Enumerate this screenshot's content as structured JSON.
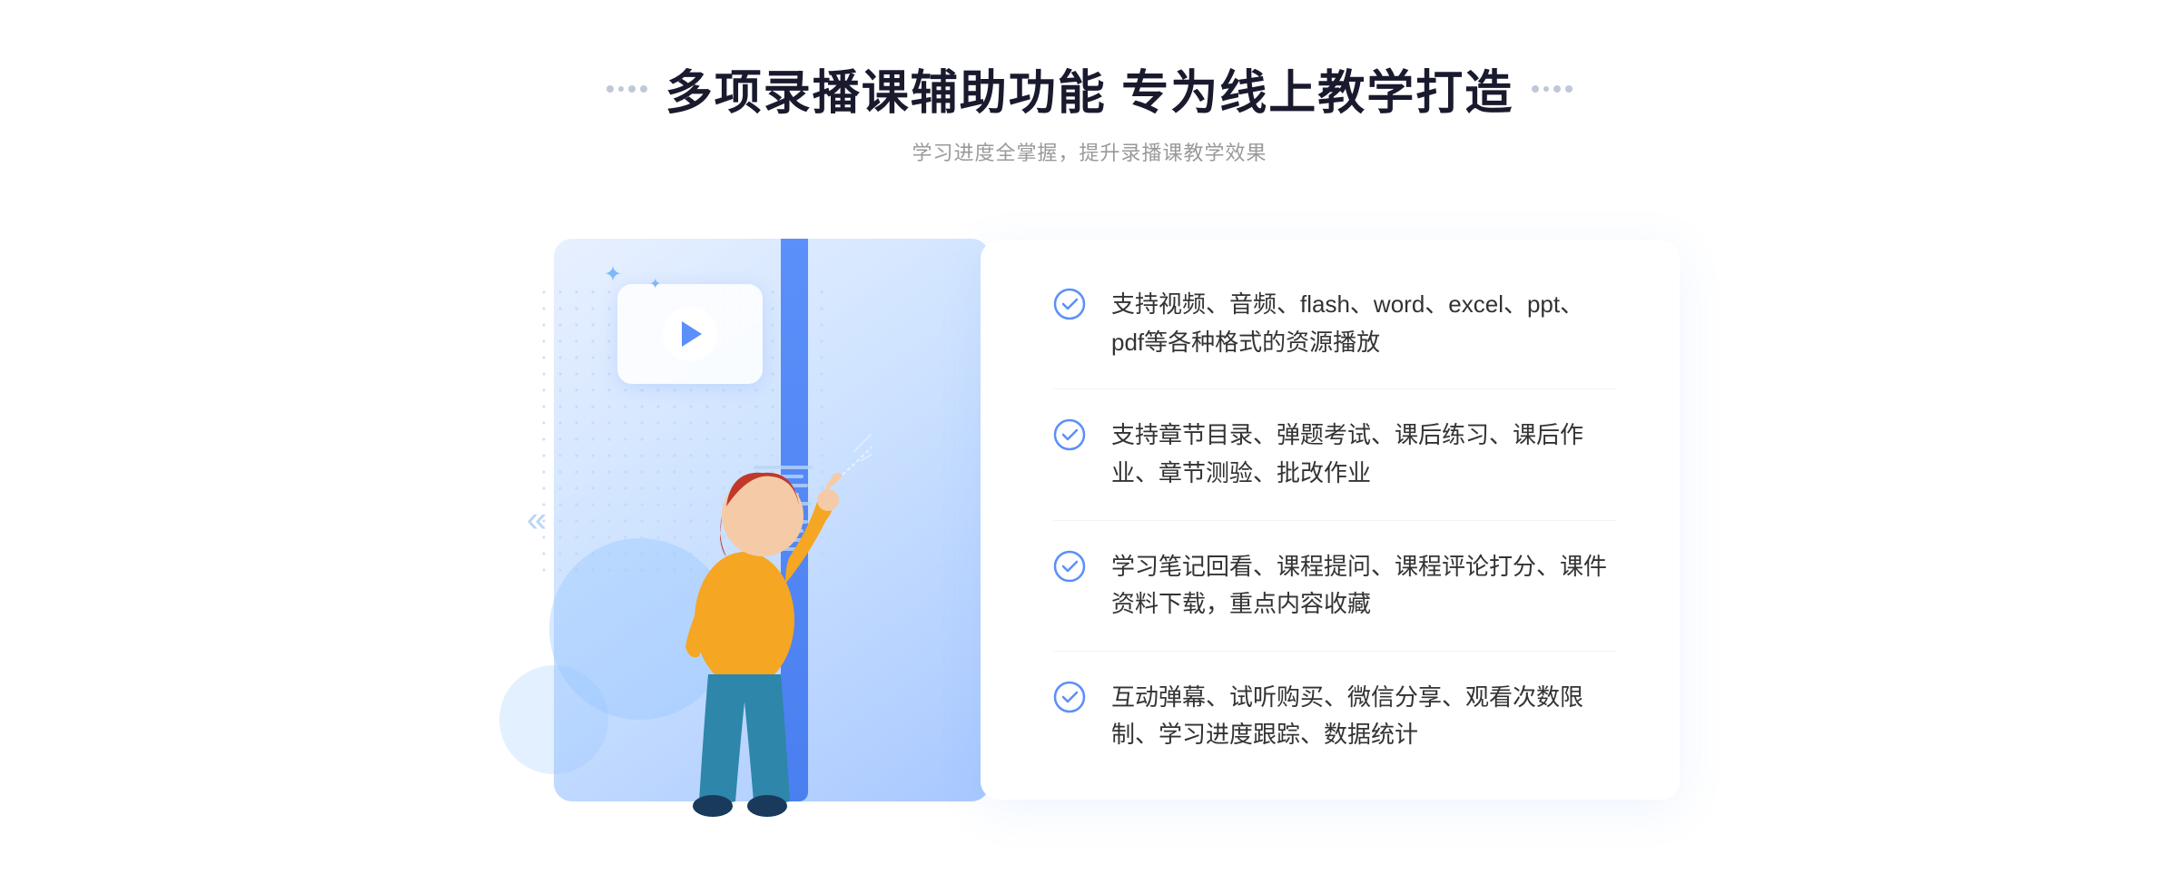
{
  "header": {
    "title": "多项录播课辅助功能 专为线上教学打造",
    "subtitle": "学习进度全掌握，提升录播课教学效果",
    "dots_left": "decorative dots left",
    "dots_right": "decorative dots right"
  },
  "features": [
    {
      "id": 1,
      "text": "支持视频、音频、flash、word、excel、ppt、pdf等各种格式的资源播放"
    },
    {
      "id": 2,
      "text": "支持章节目录、弹题考试、课后练习、课后作业、章节测验、批改作业"
    },
    {
      "id": 3,
      "text": "学习笔记回看、课程提问、课程评论打分、课件资料下载，重点内容收藏"
    },
    {
      "id": 4,
      "text": "互动弹幕、试听购买、微信分享、观看次数限制、学习进度跟踪、数据统计"
    }
  ],
  "illustration": {
    "play_button_title": "play button",
    "sparkle_symbol": "✦",
    "chevron_left": "«"
  },
  "colors": {
    "primary_blue": "#5b8ff9",
    "light_blue": "#a8c8ff",
    "text_dark": "#1a1a2e",
    "text_gray": "#999999"
  }
}
